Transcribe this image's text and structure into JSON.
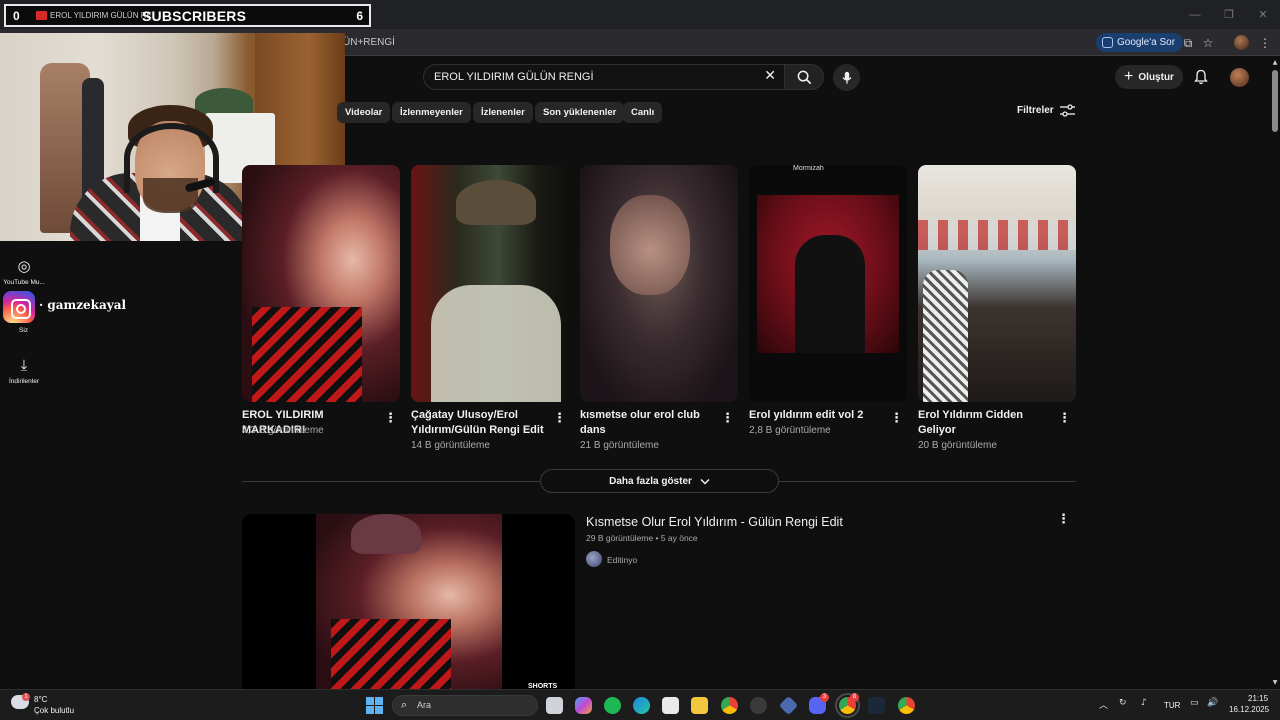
{
  "overlay": {
    "left_count": "0",
    "channel_snippet": "EROL YILDIRIM GÜLÜN RE",
    "label": "SUBSCRIBERS",
    "right_count": "6"
  },
  "browser": {
    "url_fragment": "ÜN+RENGİ",
    "gemini_label": "Google'a Sor"
  },
  "rail": {
    "youtube_music_label": "YouTube Mu...",
    "you_label": "Siz",
    "downloads_label": "İndirilenler"
  },
  "instagram": {
    "handle": "· gamzekayal"
  },
  "header": {
    "search_value": "EROL YILDIRIM GÜLÜN RENGİ",
    "create_label": "Oluştur"
  },
  "chips": [
    "Videolar",
    "İzlenmeyenler",
    "İzlenenler",
    "Son yüklenenler",
    "Canlı"
  ],
  "filters_label": "Filtreler",
  "shorts": [
    {
      "title": "EROL YILDIRIM MARKADIR!",
      "views": "4,3 B görüntüleme"
    },
    {
      "title": "Çağatay Ulusoy/Erol Yıldırım/Gülün Rengi Edit ...",
      "views": "14 B görüntüleme"
    },
    {
      "title": "kısmetse olur erol club dans",
      "views": "21 B görüntüleme"
    },
    {
      "title": "Erol yıldırım edit vol 2",
      "views": "2,8 B görüntüleme",
      "brand": "Mormizah"
    },
    {
      "title": "Erol Yıldırım Cidden Geliyor #kısmetseoluraşkıngücü",
      "views": "20 B görüntüleme"
    }
  ],
  "show_more_label": "Daha fazla göster",
  "video": {
    "title": "Kısmetse Olur Erol Yıldırım - Gülün Rengi Edit",
    "meta": "29 B görüntüleme • 5 ay önce",
    "channel": "Editinyo",
    "tag": "SHORTS"
  },
  "taskbar": {
    "temperature": "8°C",
    "weather_desc": "Çok bulutlu",
    "weather_badge": "1",
    "search_placeholder": "Ara",
    "discord_badge": "3",
    "chrome_badge": "8",
    "language": "TUR",
    "time": "21:15",
    "date": "16.12.2025"
  }
}
